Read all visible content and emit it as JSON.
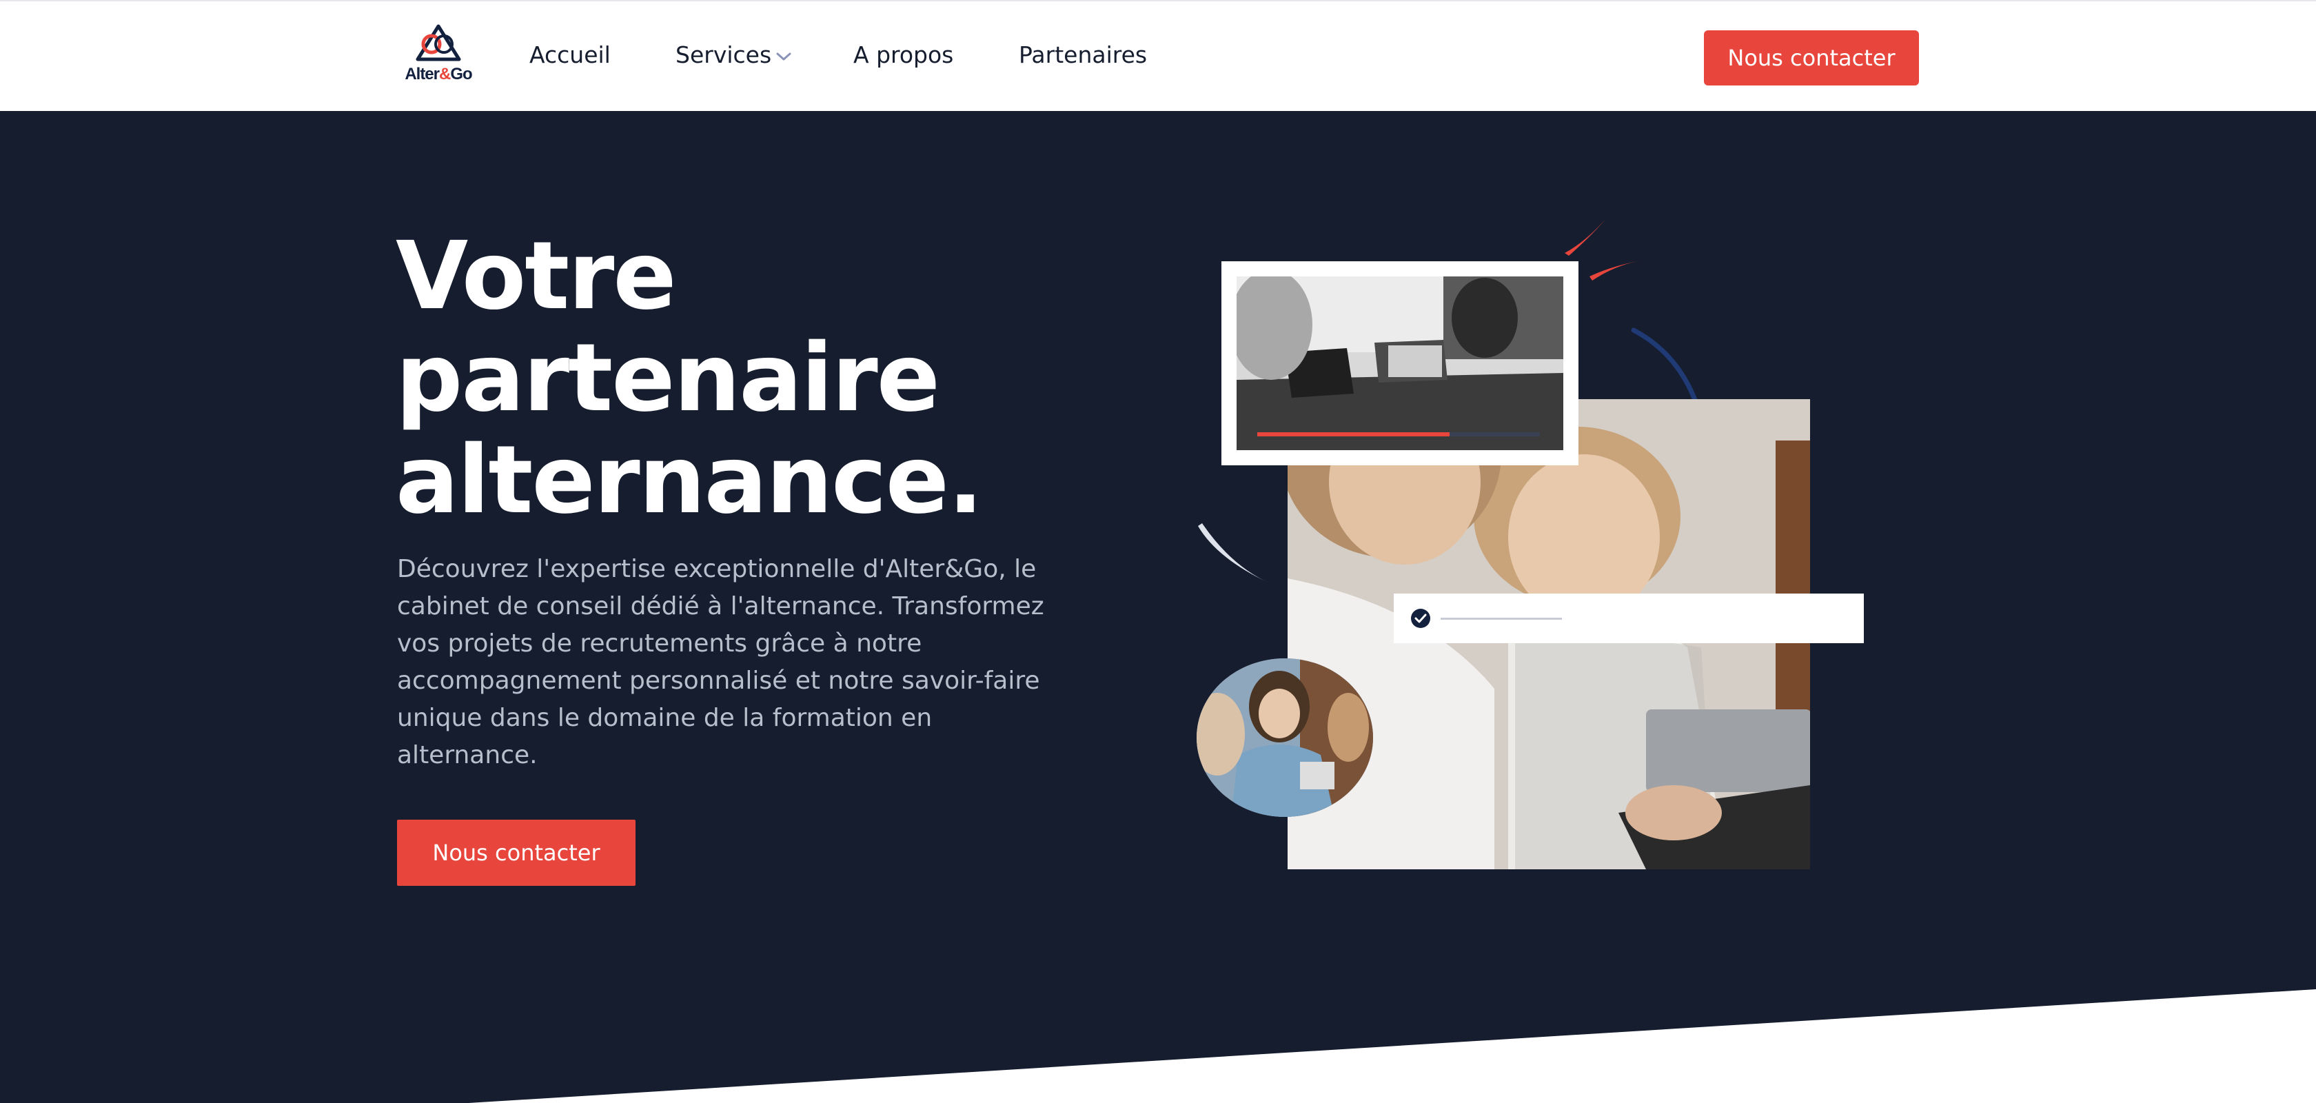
{
  "brand": {
    "name_prefix": "Alter",
    "name_amp": "&",
    "name_suffix": "Go"
  },
  "nav": {
    "items": [
      {
        "label": "Accueil"
      },
      {
        "label": "Services",
        "has_dropdown": true
      },
      {
        "label": "A propos"
      },
      {
        "label": "Partenaires"
      }
    ],
    "cta": "Nous contacter"
  },
  "hero": {
    "title_line1": "Votre",
    "title_line2": "partenaire",
    "title_line3": "alternance.",
    "description": "Découvrez l'expertise exceptionnelle d'Alter&Go, le cabinet de conseil dédié à l'alternance. Transformez vos projets de recrutements grâce à notre accompagnement personnalisé et notre savoir-faire unique dans le domaine de la formation en alternance.",
    "cta": "Nous contacter",
    "video_progress": 0.68
  },
  "colors": {
    "navy": "#151d2e",
    "brand_navy": "#13213f",
    "accent_red": "#e8453c",
    "white": "#ffffff",
    "muted_text": "#b8bfcc"
  },
  "icons": {
    "logo": "alter-go-triangle-logo",
    "dropdown": "chevron-down-icon",
    "check": "check-circle-icon"
  }
}
